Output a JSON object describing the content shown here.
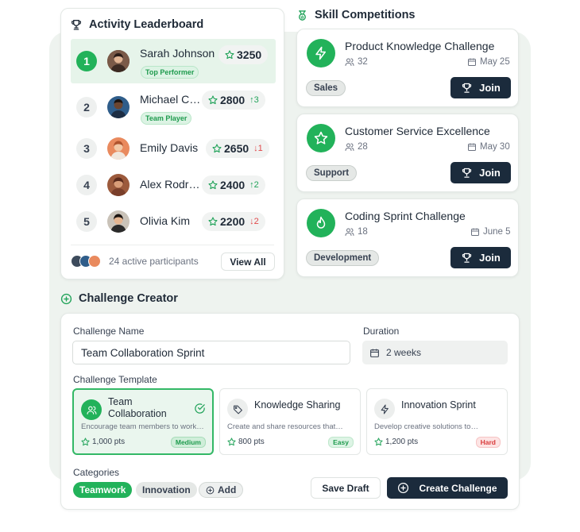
{
  "leaderboard": {
    "title": "Activity Leaderboard",
    "rows": [
      {
        "rank": "1",
        "name": "Sarah Johnson",
        "score": "3250",
        "delta": "",
        "tag": "Top Performer"
      },
      {
        "rank": "2",
        "name": "Michael C…",
        "score": "2800",
        "delta": "↑3",
        "tag": "Team Player"
      },
      {
        "rank": "3",
        "name": "Emily Davis",
        "score": "2650",
        "delta": "↓1",
        "tag": ""
      },
      {
        "rank": "4",
        "name": "Alex Rodri…",
        "score": "2400",
        "delta": "↑2",
        "tag": ""
      },
      {
        "rank": "5",
        "name": "Olivia Kim",
        "score": "2200",
        "delta": "↓2",
        "tag": ""
      }
    ],
    "participants": "24 active participants",
    "view_all": "View All"
  },
  "competitions": {
    "title": "Skill Competitions",
    "items": [
      {
        "title": "Product Knowledge Challenge",
        "people": "32",
        "date": "May 25",
        "category": "Sales",
        "join": "Join",
        "icon": "bolt-icon"
      },
      {
        "title": "Customer Service Excellence",
        "people": "28",
        "date": "May 30",
        "category": "Support",
        "join": "Join",
        "icon": "star-icon"
      },
      {
        "title": "Coding Sprint Challenge",
        "people": "18",
        "date": "June 5",
        "category": "Development",
        "join": "Join",
        "icon": "flame-icon"
      }
    ]
  },
  "creator": {
    "title": "Challenge Creator",
    "name_label": "Challenge Name",
    "name_value": "Team Collaboration Sprint",
    "duration_label": "Duration",
    "duration_value": "2 weeks",
    "template_label": "Challenge Template",
    "templates": [
      {
        "name_line1": "Team",
        "name_line2": "Collaboration",
        "desc": "Encourage team members to work…",
        "pts": "1,000 pts",
        "difficulty": "Medium"
      },
      {
        "name_line1": "Knowledge Sharing",
        "name_line2": "",
        "desc": "Create and share resources that…",
        "pts": "800 pts",
        "difficulty": "Easy"
      },
      {
        "name_line1": "Innovation Sprint",
        "name_line2": "",
        "desc": "Develop creative solutions to…",
        "pts": "1,200 pts",
        "difficulty": "Hard"
      }
    ],
    "categories_label": "Categories",
    "categories": [
      "Teamwork",
      "Innovation"
    ],
    "add_label": "Add",
    "save_draft": "Save Draft",
    "create": "Create Challenge"
  },
  "colors": {
    "accent": "#22b25a",
    "dark": "#1b2b3c",
    "up": "#22a35a",
    "down": "#e0484a"
  }
}
